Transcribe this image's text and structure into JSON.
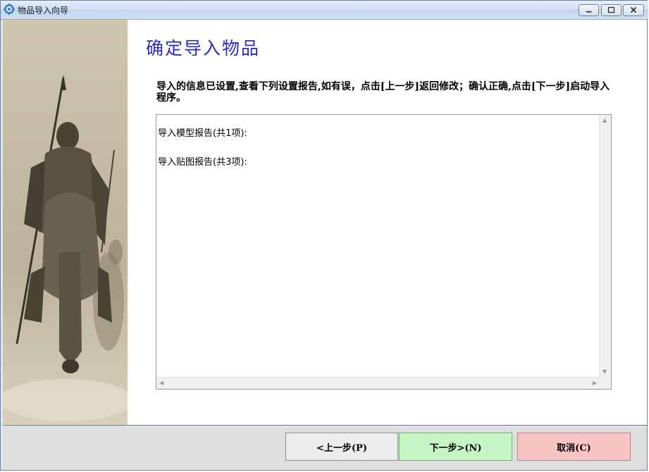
{
  "window": {
    "title": "物品导入向导"
  },
  "page": {
    "title": "确定导入物品",
    "description": "导入的信息已设置,查看下列设置报告,如有误，点击[上一步]返回修改；确认正确,点击[下一步]启动导入程序。"
  },
  "report": {
    "lines": [
      "导入模型报告(共1项):",
      "导入贴图报告(共3项):"
    ]
  },
  "buttons": {
    "prev": "<上一步(P)",
    "next": "下一步>(N)",
    "cancel": "取消(C)"
  },
  "colors": {
    "title": "#2b2bbf",
    "next_button": "#c6f5c6",
    "cancel_button": "#f8c4c4"
  }
}
